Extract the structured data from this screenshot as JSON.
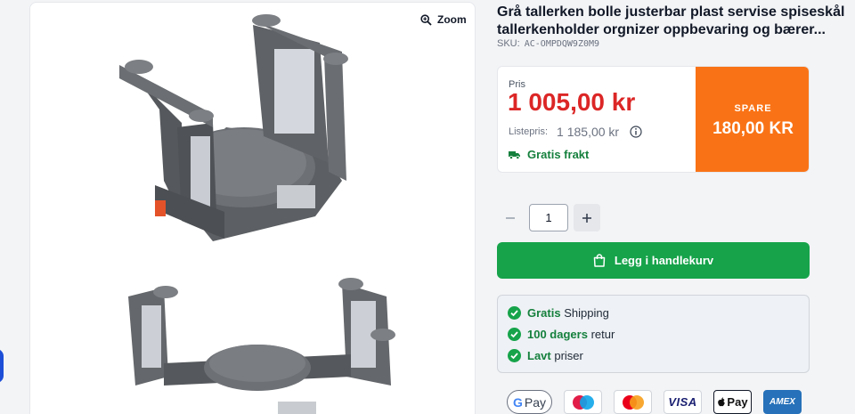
{
  "product": {
    "title": "Grå tallerken bolle justerbar plast servise spiseskål tallerkenholder orgnizer oppbevaring og bærer...",
    "sku_label": "SKU:",
    "sku_value": "AC-OMPDQW9Z0M9"
  },
  "gallery": {
    "zoom_label": "Zoom",
    "image_1": "plate-holder-angled-photo",
    "image_2": "plate-holder-extended-photo"
  },
  "price": {
    "label": "Pris",
    "current": "1 005,00 kr",
    "list_label": "Listepris:",
    "list_value": "1 185,00 kr",
    "freight": "Gratis frakt",
    "save_label": "SPARE",
    "save_value": "180,00 KR",
    "colors": {
      "price": "#dc2626",
      "save_bg": "#f97316",
      "green": "#16a34a"
    }
  },
  "quantity": {
    "value": "1"
  },
  "cart": {
    "label": "Legg i handlekurv"
  },
  "perks": [
    {
      "bold": "Gratis",
      "text": "Shipping"
    },
    {
      "bold": "100 dagers",
      "text": "retur"
    },
    {
      "bold": "Lavt",
      "text": "priser"
    }
  ],
  "payments": {
    "gpay": "Pay",
    "visa": "VISA",
    "apple": "Pay",
    "amex": "AMEX"
  }
}
